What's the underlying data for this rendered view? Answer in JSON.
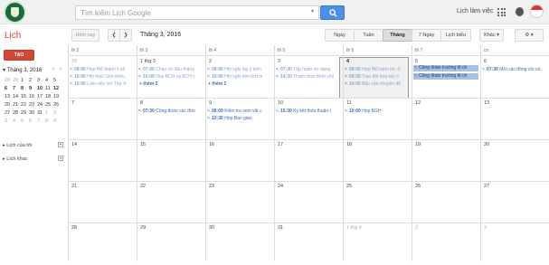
{
  "topbar": {
    "search_placeholder": "Tìm kiếm Lịch Google",
    "workplace_label": "Lịch làm việc"
  },
  "subbar": {
    "page_title": "Lịch",
    "today_label": "Hôm nay",
    "current_month": "Tháng 3, 2016",
    "views": [
      "Ngày",
      "Tuần",
      "Tháng",
      "7 Ngày",
      "Lịch biểu"
    ],
    "more_label": "Khác ▾",
    "settings_label": "⚙ ▾"
  },
  "sidebar": {
    "create_label": "TẠO",
    "mini_month": "Tháng 3, 2016",
    "mini_rows": [
      [
        "28",
        "29",
        "1",
        "2",
        "3",
        "4",
        "5"
      ],
      [
        "6",
        "7",
        "8",
        "9",
        "10",
        "11",
        "12"
      ],
      [
        "13",
        "14",
        "15",
        "16",
        "17",
        "18",
        "19"
      ],
      [
        "20",
        "21",
        "22",
        "23",
        "24",
        "25",
        "26"
      ],
      [
        "27",
        "28",
        "29",
        "30",
        "31",
        "1",
        "2"
      ],
      [
        "3",
        "4",
        "5",
        "6",
        "7",
        "8",
        "9"
      ]
    ],
    "my_calendars": "Lịch của tôi",
    "other_calendars": "Lịch khác"
  },
  "grid": {
    "dow": [
      "th 2",
      "th 3",
      "th 4",
      "th 5",
      "th 6",
      "th 7",
      "cn"
    ],
    "weeks": [
      [
        "29",
        "1 thg 3",
        "2",
        "3",
        "4",
        "5",
        "6"
      ],
      [
        "7",
        "8",
        "9",
        "10",
        "11",
        "12",
        "13"
      ],
      [
        "14",
        "15",
        "16",
        "17",
        "18",
        "19",
        "20"
      ],
      [
        "21",
        "22",
        "23",
        "24",
        "25",
        "26",
        "27"
      ],
      [
        "28",
        "29",
        "30",
        "31",
        "1 thg 4",
        "2",
        "3"
      ]
    ],
    "events": {
      "w0d0": [
        {
          "time": "08:00",
          "title": "Họp HĐ thành lị ph"
        },
        {
          "time": "15:00",
          "title": "Hội thảo Giới thiệu"
        },
        {
          "time": "16:00",
          "title": "Làm việc với Thứ tr"
        }
      ],
      "w0d1": [
        {
          "time": "07:00",
          "title": "Chào cờ đầu tháng"
        },
        {
          "time": "10:00",
          "title": "Họp BCH và BCH c"
        }
      ],
      "w0d2": [
        {
          "time": "08:00",
          "title": "Hội nghị lấy ý kiến"
        },
        {
          "time": "10:00",
          "title": "Hội nghị tiền lịch m"
        }
      ],
      "w0d3": [
        {
          "time": "07:30",
          "title": "Tập huấn sử dụng"
        },
        {
          "time": "14:30",
          "title": "Tham mưu trình chủ"
        }
      ],
      "w0d4": [
        {
          "time": "08:00",
          "title": "Họp HĐ kiểm kê, đ"
        },
        {
          "time": "09:30",
          "title": "Trao đổi hợp tác n"
        },
        {
          "time": "14:00",
          "title": "Báo cáo chuyên đề"
        }
      ],
      "w0d5": [
        {
          "time": "",
          "title": "Công đoàn trường tổ ch"
        },
        {
          "time": "",
          "title": "Công đoàn trường tổ ch"
        }
      ],
      "w0d6": [
        {
          "time": "07:30",
          "title": "Mời các đồng chí cá"
        }
      ],
      "w1d1": [
        {
          "time": "07:30",
          "title": "Công đoàn các đơn"
        }
      ],
      "w1d2": [
        {
          "time": "08:00",
          "title": "Kiểm tra xem vật c"
        },
        {
          "time": "13:30",
          "title": "Họp Ban giao"
        }
      ],
      "w1d3": [
        {
          "time": "15:30",
          "title": "Kỷ kết thỏa thuận t"
        }
      ],
      "w1d4": [
        {
          "time": "10:00",
          "title": "Họp BGH"
        }
      ]
    },
    "more_w0d1": "+ thêm 2",
    "more_w0d2": "+ thêm 2"
  },
  "colors": {
    "accent_red": "#d14836",
    "search_blue": "#4d8ee8",
    "event_blue": "#3a6fb3",
    "event_block": "#a4c2e4"
  }
}
